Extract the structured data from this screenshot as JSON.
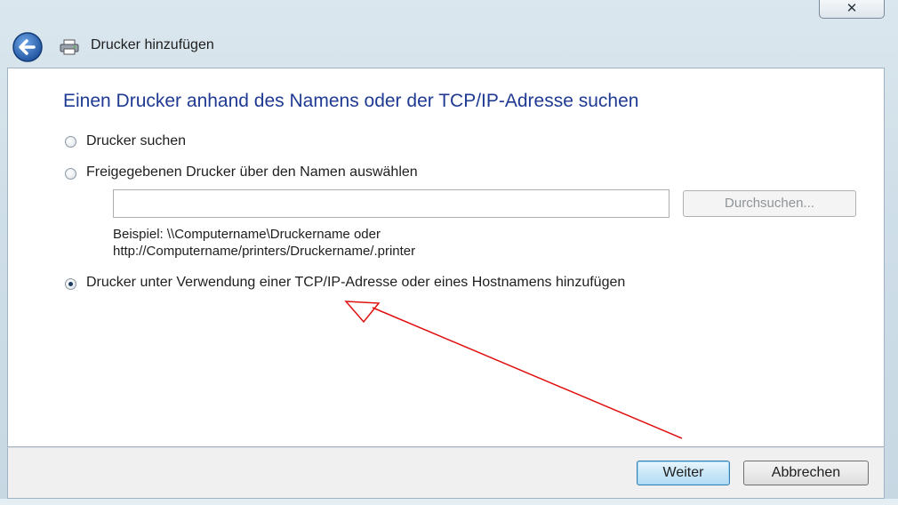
{
  "window": {
    "close_symbol": "✕",
    "title": "Drucker hinzufügen",
    "back_icon": "back-arrow-icon",
    "printer_icon": "printer-icon"
  },
  "page": {
    "heading": "Einen Drucker anhand des Namens oder der TCP/IP-Adresse suchen"
  },
  "options": {
    "search_label": "Drucker suchen",
    "shared_label": "Freigegebenen Drucker über den Namen auswählen",
    "shared_input_value": "",
    "browse_label": "Durchsuchen...",
    "example_line1": "Beispiel: \\\\Computername\\Druckername oder",
    "example_line2": "http://Computername/printers/Druckername/.printer",
    "tcpip_label": "Drucker unter Verwendung einer TCP/IP-Adresse oder eines Hostnamens hinzufügen",
    "selected": "tcpip"
  },
  "footer": {
    "next_label": "Weiter",
    "cancel_label": "Abbrechen"
  },
  "colors": {
    "heading": "#1f3a93",
    "annotation_arrow": "#e01010"
  }
}
